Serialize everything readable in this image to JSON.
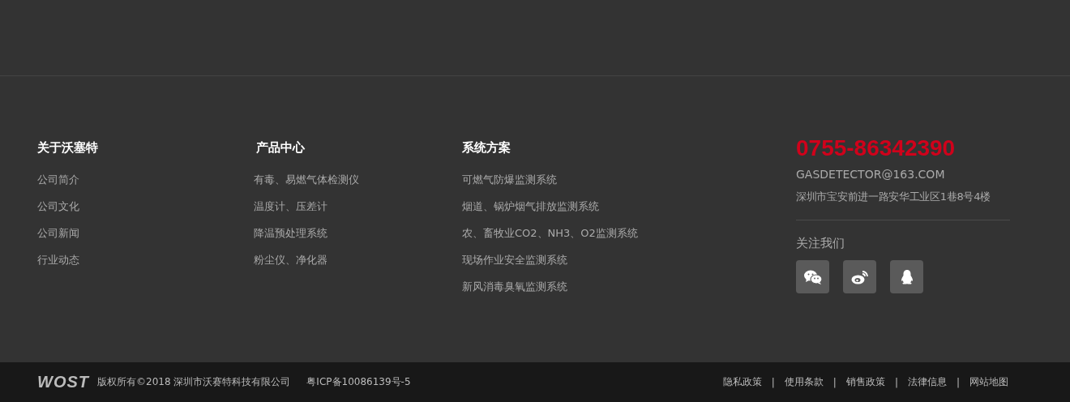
{
  "columns": [
    {
      "title": "关于沃塞特",
      "links": [
        "公司简介",
        "公司文化",
        "公司新闻",
        "行业动态"
      ]
    },
    {
      "title": "产品中心",
      "links": [
        "有毒、易燃气体检测仪",
        "温度计、压差计",
        "降温预处理系统",
        "粉尘仪、净化器"
      ]
    },
    {
      "title": "系统方案",
      "links": [
        "可燃气防爆监测系统",
        "烟道、锅炉烟气排放监测系统",
        "农、畜牧业CO2、NH3、O2监测系统",
        "现场作业安全监测系统",
        "新风消毒臭氧监测系统"
      ]
    }
  ],
  "contact": {
    "phone": "0755-86342390",
    "email": "GASDETECTOR@163.COM",
    "address": "深圳市宝安前进一路安华工业区1巷8号4楼",
    "follow_title": "关注我们",
    "social": [
      {
        "kind": "wechat"
      },
      {
        "kind": "weibo"
      },
      {
        "kind": "qq"
      }
    ]
  },
  "bottom_bar": {
    "logo": "WOST",
    "copyright": "版权所有©2018 深圳市沃赛特科技有限公司",
    "icp": "粤ICP备10086139号-5",
    "links": [
      "隐私政策",
      "使用条款",
      "销售政策",
      "法律信息",
      "网站地图"
    ],
    "separator": "|"
  }
}
